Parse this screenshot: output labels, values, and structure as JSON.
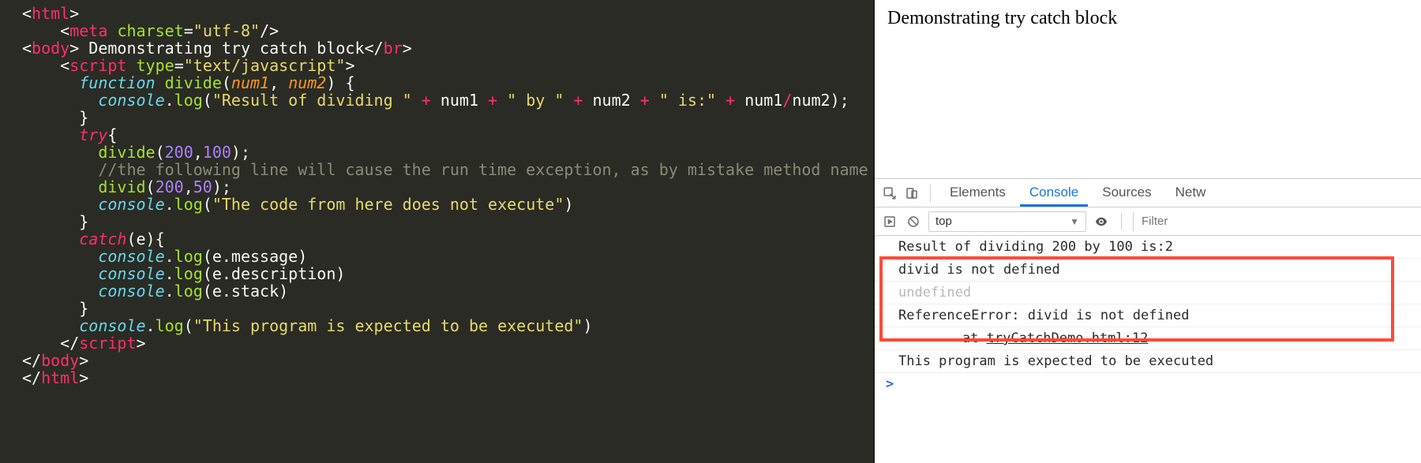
{
  "page": {
    "heading": "Demonstrating try catch block"
  },
  "code": {
    "tokens": [
      [
        [
          "<",
          "c-punc"
        ],
        [
          "html",
          "c-tag"
        ],
        [
          ">",
          "c-punc"
        ]
      ],
      [
        [
          "    ",
          "c-punc"
        ],
        [
          "<",
          "c-punc"
        ],
        [
          "meta",
          "c-tag"
        ],
        [
          " ",
          "c-punc"
        ],
        [
          "charset",
          "c-attr"
        ],
        [
          "=",
          "c-punc"
        ],
        [
          "\"utf-8\"",
          "c-str"
        ],
        [
          "/>",
          "c-punc"
        ]
      ],
      [
        [
          "<",
          "c-punc"
        ],
        [
          "body",
          "c-tag"
        ],
        [
          ">",
          "c-punc"
        ],
        [
          " Demonstrating try catch block",
          "c-punc"
        ],
        [
          "<",
          "c-punc"
        ],
        [
          "/",
          "c-punc"
        ],
        [
          "br",
          "c-tag"
        ],
        [
          ">",
          "c-punc"
        ]
      ],
      [
        [
          "    ",
          "c-punc"
        ],
        [
          "<",
          "c-punc"
        ],
        [
          "script",
          "c-tag"
        ],
        [
          " ",
          "c-punc"
        ],
        [
          "type",
          "c-attr"
        ],
        [
          "=",
          "c-punc"
        ],
        [
          "\"text/javascript\"",
          "c-str"
        ],
        [
          ">",
          "c-punc"
        ]
      ],
      [
        [
          "      ",
          "c-punc"
        ],
        [
          "function",
          "c-kw"
        ],
        [
          " ",
          "c-punc"
        ],
        [
          "divide",
          "c-func"
        ],
        [
          "(",
          "c-punc"
        ],
        [
          "num1",
          "c-arg"
        ],
        [
          ", ",
          "c-punc"
        ],
        [
          "num2",
          "c-arg"
        ],
        [
          ") {",
          "c-punc"
        ]
      ],
      [
        [
          "        ",
          "c-punc"
        ],
        [
          "console",
          "c-obj"
        ],
        [
          ".",
          "c-punc"
        ],
        [
          "log",
          "c-func"
        ],
        [
          "(",
          "c-punc"
        ],
        [
          "\"Result of dividing \"",
          "c-str"
        ],
        [
          " + ",
          "c-tag"
        ],
        [
          "num1",
          "c-punc"
        ],
        [
          " + ",
          "c-tag"
        ],
        [
          "\" by \"",
          "c-str"
        ],
        [
          " + ",
          "c-tag"
        ],
        [
          "num2",
          "c-punc"
        ],
        [
          " + ",
          "c-tag"
        ],
        [
          "\" is:\"",
          "c-str"
        ],
        [
          " + ",
          "c-tag"
        ],
        [
          "num1",
          "c-punc"
        ],
        [
          "/",
          "c-tag"
        ],
        [
          "num2",
          "c-punc"
        ],
        [
          ");",
          "c-punc"
        ]
      ],
      [
        [
          "      }",
          "c-punc"
        ]
      ],
      [
        [
          "",
          "c-punc"
        ]
      ],
      [
        [
          "      ",
          "c-punc"
        ],
        [
          "try",
          "c-key"
        ],
        [
          "{",
          "c-punc"
        ]
      ],
      [
        [
          "        ",
          "c-punc"
        ],
        [
          "divide",
          "c-func"
        ],
        [
          "(",
          "c-punc"
        ],
        [
          "200",
          "c-num"
        ],
        [
          ",",
          "c-punc"
        ],
        [
          "100",
          "c-num"
        ],
        [
          ");",
          "c-punc"
        ]
      ],
      [
        [
          "        ",
          "c-punc"
        ],
        [
          "//the following line will cause the run time exception, as by mistake method name is wrong",
          "c-cmt"
        ]
      ],
      [
        [
          "        ",
          "c-punc"
        ],
        [
          "divid",
          "c-func"
        ],
        [
          "(",
          "c-punc"
        ],
        [
          "200",
          "c-num"
        ],
        [
          ",",
          "c-punc"
        ],
        [
          "50",
          "c-num"
        ],
        [
          ");",
          "c-punc"
        ]
      ],
      [
        [
          "        ",
          "c-punc"
        ],
        [
          "console",
          "c-obj"
        ],
        [
          ".",
          "c-punc"
        ],
        [
          "log",
          "c-func"
        ],
        [
          "(",
          "c-punc"
        ],
        [
          "\"The code from here does not execute\"",
          "c-str"
        ],
        [
          ")",
          "c-punc"
        ]
      ],
      [
        [
          "      }",
          "c-punc"
        ]
      ],
      [
        [
          "      ",
          "c-punc"
        ],
        [
          "catch",
          "c-key"
        ],
        [
          "(e){",
          "c-punc"
        ]
      ],
      [
        [
          "        ",
          "c-punc"
        ],
        [
          "console",
          "c-obj"
        ],
        [
          ".",
          "c-punc"
        ],
        [
          "log",
          "c-func"
        ],
        [
          "(e.message)",
          "c-punc"
        ]
      ],
      [
        [
          "        ",
          "c-punc"
        ],
        [
          "console",
          "c-obj"
        ],
        [
          ".",
          "c-punc"
        ],
        [
          "log",
          "c-func"
        ],
        [
          "(e.description)",
          "c-punc"
        ]
      ],
      [
        [
          "        ",
          "c-punc"
        ],
        [
          "console",
          "c-obj"
        ],
        [
          ".",
          "c-punc"
        ],
        [
          "log",
          "c-func"
        ],
        [
          "(e.stack)",
          "c-punc"
        ]
      ],
      [
        [
          "      }",
          "c-punc"
        ]
      ],
      [
        [
          "      ",
          "c-punc"
        ],
        [
          "console",
          "c-obj"
        ],
        [
          ".",
          "c-punc"
        ],
        [
          "log",
          "c-func"
        ],
        [
          "(",
          "c-punc"
        ],
        [
          "\"This program is expected to be executed\"",
          "c-str"
        ],
        [
          ")",
          "c-punc"
        ]
      ],
      [
        [
          "    ",
          "c-punc"
        ],
        [
          "</",
          "c-punc"
        ],
        [
          "script",
          "c-tag"
        ],
        [
          ">",
          "c-punc"
        ]
      ],
      [
        [
          "</",
          "c-punc"
        ],
        [
          "body",
          "c-tag"
        ],
        [
          ">",
          "c-punc"
        ]
      ],
      [
        [
          "</",
          "c-punc"
        ],
        [
          "html",
          "c-tag"
        ],
        [
          ">",
          "c-punc"
        ]
      ]
    ]
  },
  "devtools": {
    "tabs": {
      "elements": "Elements",
      "console": "Console",
      "sources": "Sources",
      "network": "Netw"
    },
    "context": "top",
    "filter_placeholder": "Filter",
    "rows": [
      {
        "text": "Result of dividing 200 by 100 is:2",
        "dim": false
      },
      {
        "text": "divid is not defined",
        "dim": false
      },
      {
        "text": "undefined",
        "dim": true
      },
      {
        "text": "ReferenceError: divid is not defined",
        "dim": false
      },
      {
        "text": "    at ",
        "link": "tryCatchDemo.html:12",
        "indent": true
      },
      {
        "text": "This program is expected to be executed",
        "dim": false
      }
    ],
    "prompt": ">"
  }
}
